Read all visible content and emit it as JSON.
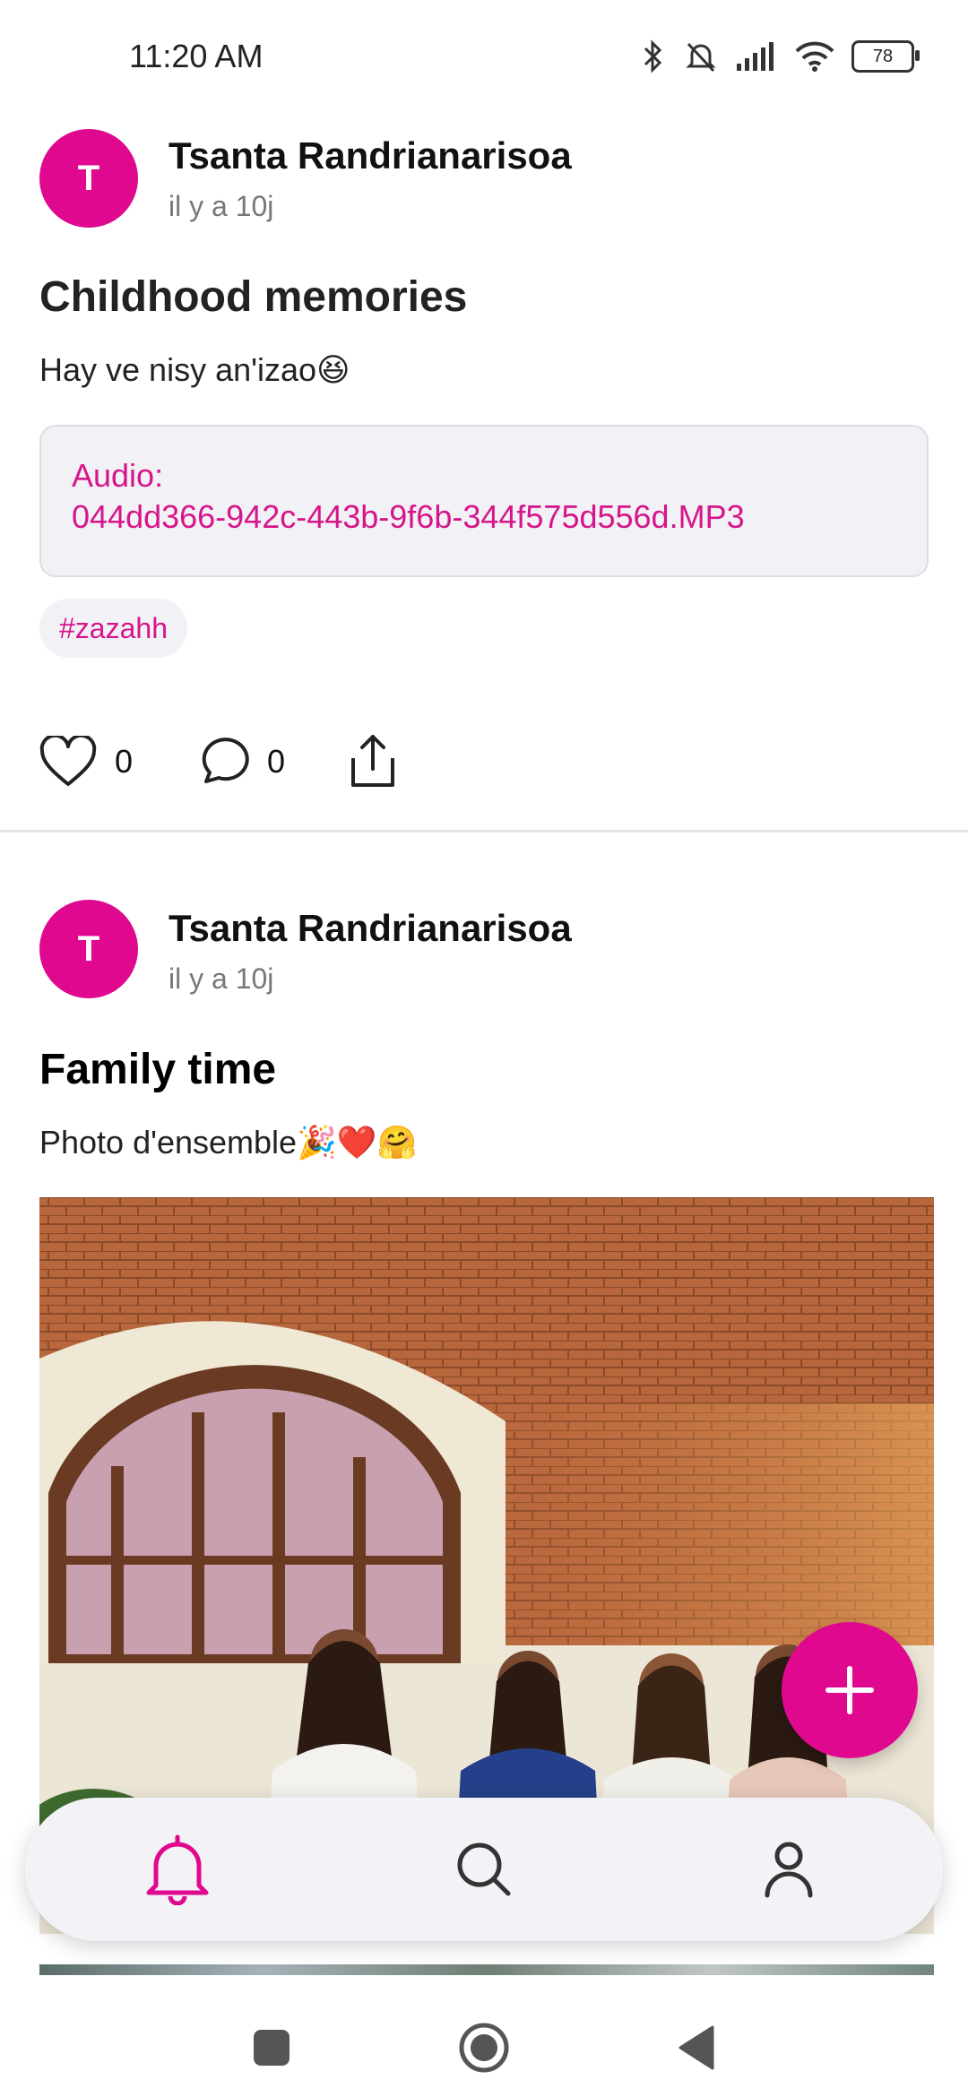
{
  "status_bar": {
    "time": "11:20 AM",
    "battery": "78"
  },
  "posts": [
    {
      "avatar_initial": "T",
      "author": "Tsanta Randrianarisoa",
      "time": "il y a 10j",
      "title": "Childhood memories",
      "body": "Hay ve nisy an'izao😆",
      "audio_label": "Audio:",
      "audio_file": "044dd366-942c-443b-9f6b-344f575d556d.MP3",
      "tag": "#zazahh",
      "likes": "0",
      "comments": "0"
    },
    {
      "avatar_initial": "T",
      "author": "Tsanta Randrianarisoa",
      "time": "il y a 10j",
      "title": "Family time",
      "body": "Photo d'ensemble🎉❤️🤗"
    }
  ],
  "colors": {
    "accent": "#e0088e",
    "card_bg": "#f2f1f5"
  },
  "bottom_nav": [
    "bell-icon",
    "search-icon",
    "profile-icon"
  ]
}
